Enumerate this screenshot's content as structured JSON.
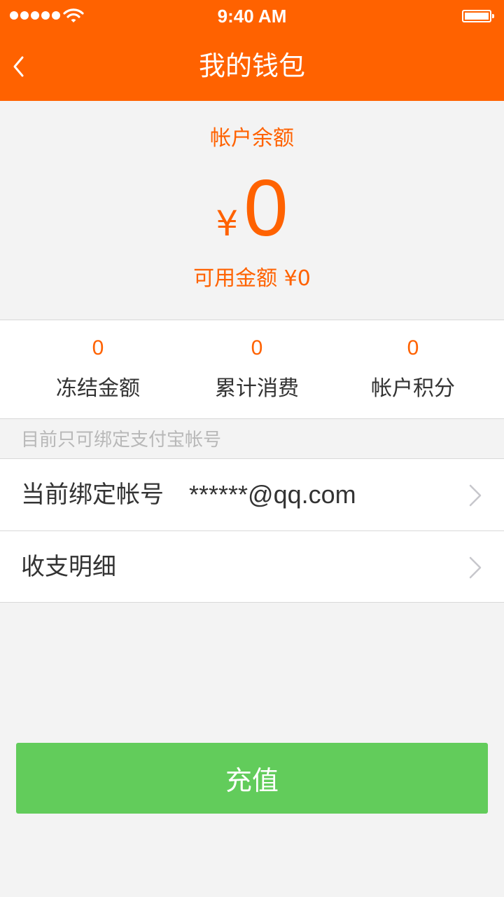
{
  "status_bar": {
    "time": "9:40 AM",
    "signal_icon": "signal-dots-icon",
    "wifi_icon": "wifi-icon",
    "battery_icon": "battery-icon"
  },
  "nav": {
    "title": "我的钱包",
    "back_icon": "chevron-left-icon"
  },
  "balance": {
    "label": "帐户余额",
    "currency": "¥",
    "amount": "0",
    "available": "可用金额 ¥0"
  },
  "stats": [
    {
      "value": "0",
      "label": "冻结金额"
    },
    {
      "value": "0",
      "label": "累计消费"
    },
    {
      "value": "0",
      "label": "帐户积分"
    }
  ],
  "hint": "目前只可绑定支付宝帐号",
  "list": [
    {
      "label": "当前绑定帐号",
      "value": "******@qq.com"
    },
    {
      "label": "收支明细",
      "value": ""
    }
  ],
  "recharge_button": "充值",
  "colors": {
    "accent": "#ff6200",
    "button": "#62cc5b",
    "background": "#f3f3f3"
  }
}
